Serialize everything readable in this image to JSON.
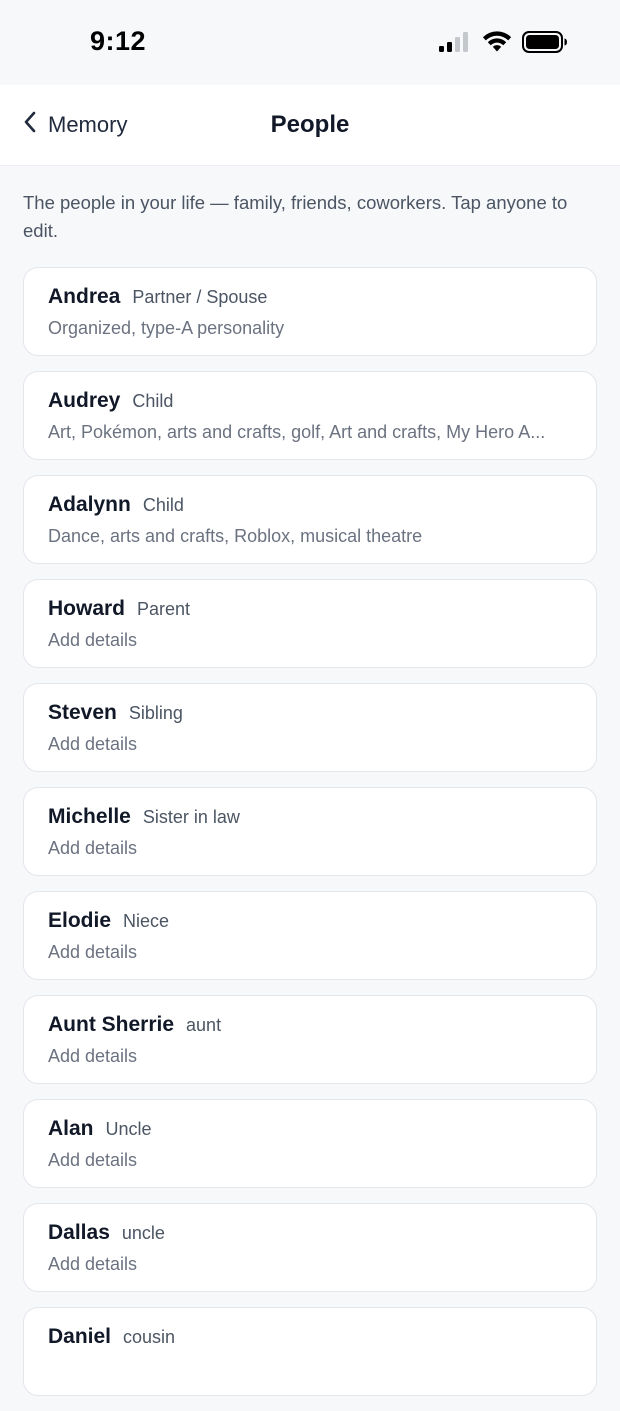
{
  "status_bar": {
    "time": "9:12",
    "icons": [
      "cellular-signal-icon",
      "wifi-icon",
      "battery-icon"
    ]
  },
  "nav": {
    "back_label": "Memory",
    "title": "People"
  },
  "intro_text": "The people in your life — family, friends, coworkers. Tap anyone to edit.",
  "people": [
    {
      "name": "Andrea",
      "relation": "Partner / Spouse",
      "details": "Organized, type-A personality"
    },
    {
      "name": "Audrey",
      "relation": "Child",
      "details": "Art, Pokémon, arts and crafts, golf, Art and crafts, My Hero A..."
    },
    {
      "name": "Adalynn",
      "relation": "Child",
      "details": "Dance, arts and crafts, Roblox, musical theatre"
    },
    {
      "name": "Howard",
      "relation": "Parent",
      "details": "Add details"
    },
    {
      "name": "Steven",
      "relation": "Sibling",
      "details": "Add details"
    },
    {
      "name": "Michelle",
      "relation": "Sister in law",
      "details": "Add details"
    },
    {
      "name": "Elodie",
      "relation": "Niece",
      "details": "Add details"
    },
    {
      "name": "Aunt Sherrie",
      "relation": "aunt",
      "details": "Add details"
    },
    {
      "name": "Alan",
      "relation": "Uncle",
      "details": "Add details"
    },
    {
      "name": "Dallas",
      "relation": "uncle",
      "details": "Add details"
    },
    {
      "name": "Daniel",
      "relation": "cousin",
      "details": ""
    }
  ],
  "colors": {
    "background": "#f7f8fa",
    "card_background": "#ffffff",
    "card_border": "#e3e6eb",
    "text_primary": "#111827",
    "text_secondary": "#4b5563",
    "text_muted": "#6b7280"
  }
}
